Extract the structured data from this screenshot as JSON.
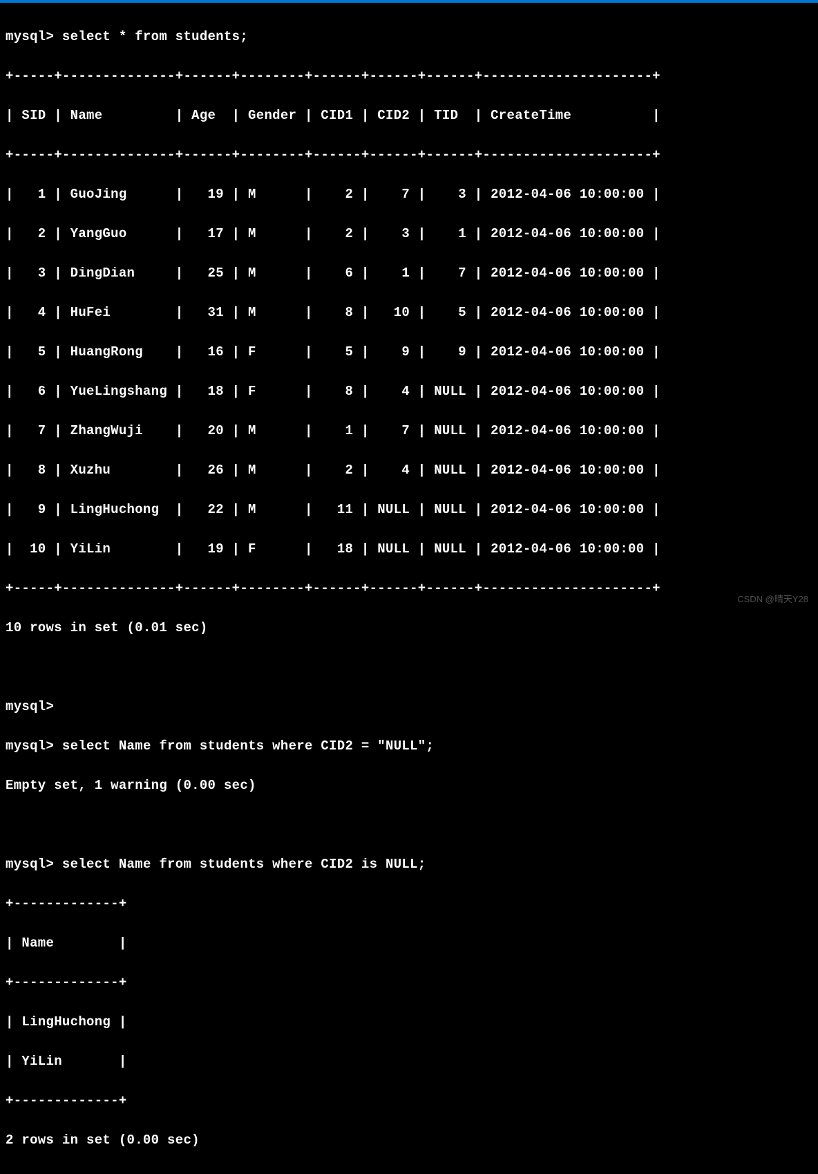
{
  "top_bar_color": "#0078d4",
  "query1": {
    "prompt": "mysql> ",
    "sql": "select * from students;"
  },
  "table1": {
    "border_top": "+-----+--------------+------+--------+------+------+------+---------------------+",
    "header_row": "| SID | Name         | Age  | Gender | CID1 | CID2 | TID  | CreateTime          |",
    "border_mid": "+-----+--------------+------+--------+------+------+------+---------------------+",
    "rows": [
      "|   1 | GuoJing      |   19 | M      |    2 |    7 |    3 | 2012-04-06 10:00:00 |",
      "|   2 | YangGuo      |   17 | M      |    2 |    3 |    1 | 2012-04-06 10:00:00 |",
      "|   3 | DingDian     |   25 | M      |    6 |    1 |    7 | 2012-04-06 10:00:00 |",
      "|   4 | HuFei        |   31 | M      |    8 |   10 |    5 | 2012-04-06 10:00:00 |",
      "|   5 | HuangRong    |   16 | F      |    5 |    9 |    9 | 2012-04-06 10:00:00 |",
      "|   6 | YueLingshang |   18 | F      |    8 |    4 | NULL | 2012-04-06 10:00:00 |",
      "|   7 | ZhangWuji    |   20 | M      |    1 |    7 | NULL | 2012-04-06 10:00:00 |",
      "|   8 | Xuzhu        |   26 | M      |    2 |    4 | NULL | 2012-04-06 10:00:00 |",
      "|   9 | LingHuchong  |   22 | M      |   11 | NULL | NULL | 2012-04-06 10:00:00 |",
      "|  10 | YiLin        |   19 | F      |   18 | NULL | NULL | 2012-04-06 10:00:00 |"
    ],
    "border_bot": "+-----+--------------+------+--------+------+------+------+---------------------+",
    "result_status": "10 rows in set (0.01 sec)"
  },
  "empty_prompt": "mysql> ",
  "query2": {
    "prompt": "mysql> ",
    "sql": "select Name from students where CID2 = \"NULL\";",
    "result_status": "Empty set, 1 warning (0.00 sec)"
  },
  "query3": {
    "prompt": "mysql> ",
    "sql": "select Name from students where CID2 is NULL;"
  },
  "table2": {
    "border_top": "+-------------+",
    "header_row": "| Name        |",
    "border_mid": "+-------------+",
    "rows": [
      "| LingHuchong |",
      "| YiLin       |"
    ],
    "border_bot": "+-------------+",
    "result_status": "2 rows in set (0.00 sec)"
  },
  "chart_data": [
    {
      "type": "table",
      "title": "students",
      "columns": [
        "SID",
        "Name",
        "Age",
        "Gender",
        "CID1",
        "CID2",
        "TID",
        "CreateTime"
      ],
      "rows": [
        [
          1,
          "GuoJing",
          19,
          "M",
          2,
          7,
          3,
          "2012-04-06 10:00:00"
        ],
        [
          2,
          "YangGuo",
          17,
          "M",
          2,
          3,
          1,
          "2012-04-06 10:00:00"
        ],
        [
          3,
          "DingDian",
          25,
          "M",
          6,
          1,
          7,
          "2012-04-06 10:00:00"
        ],
        [
          4,
          "HuFei",
          31,
          "M",
          8,
          10,
          5,
          "2012-04-06 10:00:00"
        ],
        [
          5,
          "HuangRong",
          16,
          "F",
          5,
          9,
          9,
          "2012-04-06 10:00:00"
        ],
        [
          6,
          "YueLingshang",
          18,
          "F",
          8,
          4,
          null,
          "2012-04-06 10:00:00"
        ],
        [
          7,
          "ZhangWuji",
          20,
          "M",
          1,
          7,
          null,
          "2012-04-06 10:00:00"
        ],
        [
          8,
          "Xuzhu",
          26,
          "M",
          2,
          4,
          null,
          "2012-04-06 10:00:00"
        ],
        [
          9,
          "LingHuchong",
          22,
          "M",
          11,
          null,
          null,
          "2012-04-06 10:00:00"
        ],
        [
          10,
          "YiLin",
          19,
          "F",
          18,
          null,
          null,
          "2012-04-06 10:00:00"
        ]
      ]
    },
    {
      "type": "table",
      "title": "Name where CID2 is NULL",
      "columns": [
        "Name"
      ],
      "rows": [
        [
          "LingHuchong"
        ],
        [
          "YiLin"
        ]
      ]
    }
  ],
  "watermark": "CSDN @晴天Y28"
}
